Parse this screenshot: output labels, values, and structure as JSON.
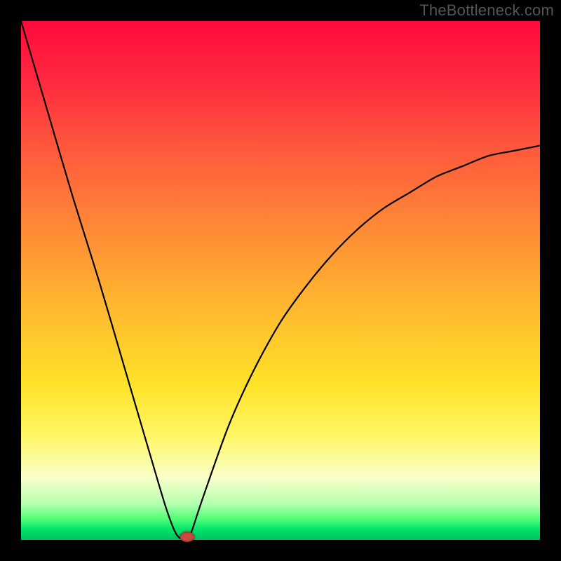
{
  "watermark": "TheBottleneck.com",
  "chart_data": {
    "type": "line",
    "title": "",
    "xlabel": "",
    "ylabel": "",
    "xlim": [
      0,
      100
    ],
    "ylim": [
      0,
      100
    ],
    "grid": false,
    "legend": null,
    "background": "heatmap-gradient red→yellow→green (top to bottom)",
    "series": [
      {
        "name": "bottleneck-curve",
        "x": [
          0,
          5,
          10,
          15,
          20,
          25,
          28,
          30,
          32,
          33,
          35,
          40,
          45,
          50,
          55,
          60,
          65,
          70,
          75,
          80,
          85,
          90,
          95,
          100
        ],
        "values": [
          100,
          83,
          66,
          50,
          33,
          16,
          6,
          1,
          0,
          2,
          8,
          22,
          33,
          42,
          49,
          55,
          60,
          64,
          67,
          70,
          72,
          74,
          75,
          76
        ]
      }
    ],
    "marker": {
      "x": 32,
      "y": 0,
      "color": "#c94a3c"
    },
    "note": "Values in chart coordinates (0–100 each axis); y=0 is bottom of plot. Points estimated from pixels."
  }
}
